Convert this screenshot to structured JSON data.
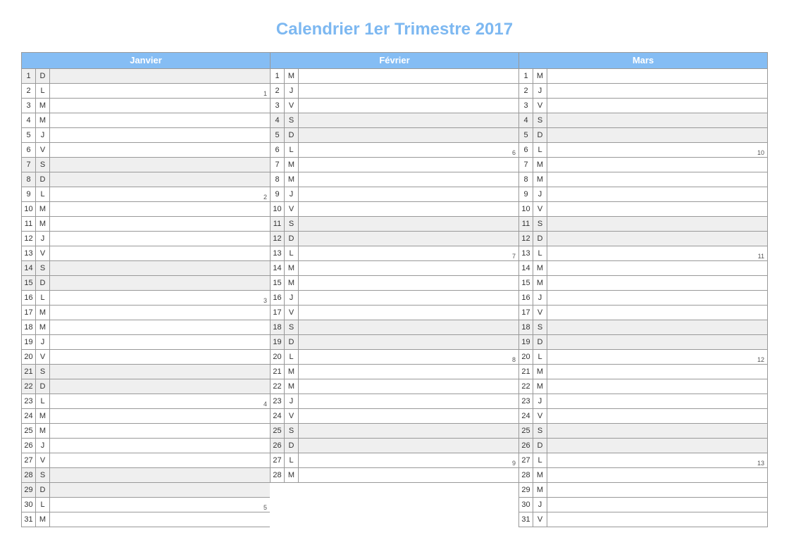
{
  "title": "Calendrier 1er Trimestre 2017",
  "colors": {
    "header_bg": "#85bdf4",
    "title": "#7db8f1",
    "shade": "#efefef"
  },
  "months": [
    {
      "name": "Janvier",
      "days": [
        {
          "d": 1,
          "w": "D",
          "shaded": true,
          "week": null
        },
        {
          "d": 2,
          "w": "L",
          "shaded": false,
          "week": 1
        },
        {
          "d": 3,
          "w": "M",
          "shaded": false,
          "week": null
        },
        {
          "d": 4,
          "w": "M",
          "shaded": false,
          "week": null
        },
        {
          "d": 5,
          "w": "J",
          "shaded": false,
          "week": null
        },
        {
          "d": 6,
          "w": "V",
          "shaded": false,
          "week": null
        },
        {
          "d": 7,
          "w": "S",
          "shaded": true,
          "week": null
        },
        {
          "d": 8,
          "w": "D",
          "shaded": true,
          "week": null
        },
        {
          "d": 9,
          "w": "L",
          "shaded": false,
          "week": 2
        },
        {
          "d": 10,
          "w": "M",
          "shaded": false,
          "week": null
        },
        {
          "d": 11,
          "w": "M",
          "shaded": false,
          "week": null
        },
        {
          "d": 12,
          "w": "J",
          "shaded": false,
          "week": null
        },
        {
          "d": 13,
          "w": "V",
          "shaded": false,
          "week": null
        },
        {
          "d": 14,
          "w": "S",
          "shaded": true,
          "week": null
        },
        {
          "d": 15,
          "w": "D",
          "shaded": true,
          "week": null
        },
        {
          "d": 16,
          "w": "L",
          "shaded": false,
          "week": 3
        },
        {
          "d": 17,
          "w": "M",
          "shaded": false,
          "week": null
        },
        {
          "d": 18,
          "w": "M",
          "shaded": false,
          "week": null
        },
        {
          "d": 19,
          "w": "J",
          "shaded": false,
          "week": null
        },
        {
          "d": 20,
          "w": "V",
          "shaded": false,
          "week": null
        },
        {
          "d": 21,
          "w": "S",
          "shaded": true,
          "week": null
        },
        {
          "d": 22,
          "w": "D",
          "shaded": true,
          "week": null
        },
        {
          "d": 23,
          "w": "L",
          "shaded": false,
          "week": 4
        },
        {
          "d": 24,
          "w": "M",
          "shaded": false,
          "week": null
        },
        {
          "d": 25,
          "w": "M",
          "shaded": false,
          "week": null
        },
        {
          "d": 26,
          "w": "J",
          "shaded": false,
          "week": null
        },
        {
          "d": 27,
          "w": "V",
          "shaded": false,
          "week": null
        },
        {
          "d": 28,
          "w": "S",
          "shaded": true,
          "week": null
        },
        {
          "d": 29,
          "w": "D",
          "shaded": true,
          "week": null
        },
        {
          "d": 30,
          "w": "L",
          "shaded": false,
          "week": 5
        },
        {
          "d": 31,
          "w": "M",
          "shaded": false,
          "week": null
        }
      ]
    },
    {
      "name": "Février",
      "days": [
        {
          "d": 1,
          "w": "M",
          "shaded": false,
          "week": null
        },
        {
          "d": 2,
          "w": "J",
          "shaded": false,
          "week": null
        },
        {
          "d": 3,
          "w": "V",
          "shaded": false,
          "week": null
        },
        {
          "d": 4,
          "w": "S",
          "shaded": true,
          "week": null
        },
        {
          "d": 5,
          "w": "D",
          "shaded": true,
          "week": null
        },
        {
          "d": 6,
          "w": "L",
          "shaded": false,
          "week": 6
        },
        {
          "d": 7,
          "w": "M",
          "shaded": false,
          "week": null
        },
        {
          "d": 8,
          "w": "M",
          "shaded": false,
          "week": null
        },
        {
          "d": 9,
          "w": "J",
          "shaded": false,
          "week": null
        },
        {
          "d": 10,
          "w": "V",
          "shaded": false,
          "week": null
        },
        {
          "d": 11,
          "w": "S",
          "shaded": true,
          "week": null
        },
        {
          "d": 12,
          "w": "D",
          "shaded": true,
          "week": null
        },
        {
          "d": 13,
          "w": "L",
          "shaded": false,
          "week": 7
        },
        {
          "d": 14,
          "w": "M",
          "shaded": false,
          "week": null
        },
        {
          "d": 15,
          "w": "M",
          "shaded": false,
          "week": null
        },
        {
          "d": 16,
          "w": "J",
          "shaded": false,
          "week": null
        },
        {
          "d": 17,
          "w": "V",
          "shaded": false,
          "week": null
        },
        {
          "d": 18,
          "w": "S",
          "shaded": true,
          "week": null
        },
        {
          "d": 19,
          "w": "D",
          "shaded": true,
          "week": null
        },
        {
          "d": 20,
          "w": "L",
          "shaded": false,
          "week": 8
        },
        {
          "d": 21,
          "w": "M",
          "shaded": false,
          "week": null
        },
        {
          "d": 22,
          "w": "M",
          "shaded": false,
          "week": null
        },
        {
          "d": 23,
          "w": "J",
          "shaded": false,
          "week": null
        },
        {
          "d": 24,
          "w": "V",
          "shaded": false,
          "week": null
        },
        {
          "d": 25,
          "w": "S",
          "shaded": true,
          "week": null
        },
        {
          "d": 26,
          "w": "D",
          "shaded": true,
          "week": null
        },
        {
          "d": 27,
          "w": "L",
          "shaded": false,
          "week": 9
        },
        {
          "d": 28,
          "w": "M",
          "shaded": false,
          "week": null
        }
      ]
    },
    {
      "name": "Mars",
      "days": [
        {
          "d": 1,
          "w": "M",
          "shaded": false,
          "week": null
        },
        {
          "d": 2,
          "w": "J",
          "shaded": false,
          "week": null
        },
        {
          "d": 3,
          "w": "V",
          "shaded": false,
          "week": null
        },
        {
          "d": 4,
          "w": "S",
          "shaded": true,
          "week": null
        },
        {
          "d": 5,
          "w": "D",
          "shaded": true,
          "week": null
        },
        {
          "d": 6,
          "w": "L",
          "shaded": false,
          "week": 10
        },
        {
          "d": 7,
          "w": "M",
          "shaded": false,
          "week": null
        },
        {
          "d": 8,
          "w": "M",
          "shaded": false,
          "week": null
        },
        {
          "d": 9,
          "w": "J",
          "shaded": false,
          "week": null
        },
        {
          "d": 10,
          "w": "V",
          "shaded": false,
          "week": null
        },
        {
          "d": 11,
          "w": "S",
          "shaded": true,
          "week": null
        },
        {
          "d": 12,
          "w": "D",
          "shaded": true,
          "week": null
        },
        {
          "d": 13,
          "w": "L",
          "shaded": false,
          "week": 11
        },
        {
          "d": 14,
          "w": "M",
          "shaded": false,
          "week": null
        },
        {
          "d": 15,
          "w": "M",
          "shaded": false,
          "week": null
        },
        {
          "d": 16,
          "w": "J",
          "shaded": false,
          "week": null
        },
        {
          "d": 17,
          "w": "V",
          "shaded": false,
          "week": null
        },
        {
          "d": 18,
          "w": "S",
          "shaded": true,
          "week": null
        },
        {
          "d": 19,
          "w": "D",
          "shaded": true,
          "week": null
        },
        {
          "d": 20,
          "w": "L",
          "shaded": false,
          "week": 12
        },
        {
          "d": 21,
          "w": "M",
          "shaded": false,
          "week": null
        },
        {
          "d": 22,
          "w": "M",
          "shaded": false,
          "week": null
        },
        {
          "d": 23,
          "w": "J",
          "shaded": false,
          "week": null
        },
        {
          "d": 24,
          "w": "V",
          "shaded": false,
          "week": null
        },
        {
          "d": 25,
          "w": "S",
          "shaded": true,
          "week": null
        },
        {
          "d": 26,
          "w": "D",
          "shaded": true,
          "week": null
        },
        {
          "d": 27,
          "w": "L",
          "shaded": false,
          "week": 13
        },
        {
          "d": 28,
          "w": "M",
          "shaded": false,
          "week": null
        },
        {
          "d": 29,
          "w": "M",
          "shaded": false,
          "week": null
        },
        {
          "d": 30,
          "w": "J",
          "shaded": false,
          "week": null
        },
        {
          "d": 31,
          "w": "V",
          "shaded": false,
          "week": null
        }
      ]
    }
  ]
}
